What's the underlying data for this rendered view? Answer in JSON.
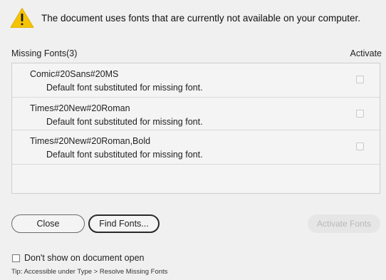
{
  "warning": {
    "icon": "warning-triangle-icon",
    "message": "The document uses fonts that are currently not available on your computer."
  },
  "list": {
    "header_title": "Missing Fonts(3)",
    "header_activate": "Activate",
    "items": [
      {
        "name": "Comic#20Sans#20MS",
        "description": "Default font substituted for missing font.",
        "activate_checked": false
      },
      {
        "name": "Times#20New#20Roman",
        "description": "Default font substituted for missing font.",
        "activate_checked": false
      },
      {
        "name": "Times#20New#20Roman,Bold",
        "description": "Default font substituted for missing font.",
        "activate_checked": false
      }
    ]
  },
  "buttons": {
    "close": "Close",
    "find_fonts": "Find Fonts...",
    "activate_fonts": "Activate Fonts",
    "activate_fonts_enabled": false
  },
  "footer": {
    "dont_show_label": "Don't show on document open",
    "dont_show_checked": false,
    "tip": "Tip: Accessible under Type > Resolve Missing Fonts"
  },
  "colors": {
    "warning_yellow": "#f5c400",
    "dialog_background": "#f0f0f0",
    "disabled_text": "#b8b8b8"
  }
}
